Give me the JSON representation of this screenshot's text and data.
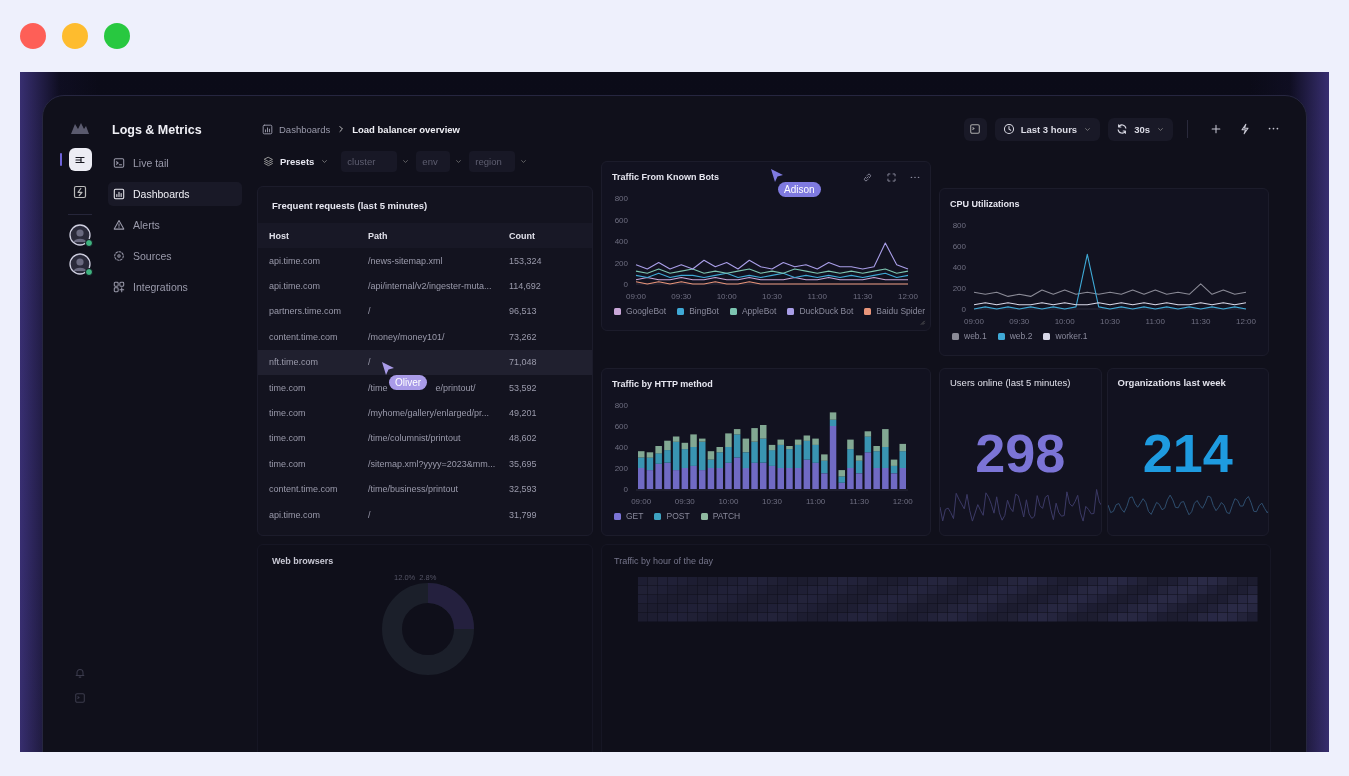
{
  "window": {
    "traffic_lights": [
      {
        "color": "#fe5f57"
      },
      {
        "color": "#febc2e"
      },
      {
        "color": "#28c840"
      }
    ]
  },
  "app": {
    "title": "Logs & Metrics"
  },
  "rail": {
    "items": [
      {
        "kind": "toggle",
        "selected": true
      },
      {
        "kind": "bolt",
        "selected": false
      }
    ],
    "avatars": [
      {
        "online": true
      },
      {
        "online": true
      }
    ]
  },
  "nav": [
    {
      "kind": "terminal",
      "label": "Live tail",
      "selected": false
    },
    {
      "kind": "dashboards",
      "label": "Dashboards",
      "selected": true
    },
    {
      "kind": "alert",
      "label": "Alerts",
      "selected": false
    },
    {
      "kind": "sources",
      "label": "Sources",
      "selected": false
    },
    {
      "kind": "integrations",
      "label": "Integrations",
      "selected": false
    }
  ],
  "breadcrumb": {
    "parent": "Dashboards",
    "current": "Load balancer overview"
  },
  "toolbar": {
    "time_range": "Last 3 hours",
    "refresh": "30s"
  },
  "filters": {
    "presets": "Presets",
    "fields": [
      {
        "placeholder": "cluster"
      },
      {
        "placeholder": "env"
      },
      {
        "placeholder": "region"
      }
    ]
  },
  "requests": {
    "title": "Frequent requests (last 5 minutes)",
    "columns": [
      "Host",
      "Path",
      "Count"
    ],
    "rows": [
      {
        "host": "api.time.com",
        "path": "/news-sitemap.xml",
        "count": "153,324",
        "selected": false
      },
      {
        "host": "api.time.com",
        "path": "/api/internal/v2/ingester-muta...",
        "count": "114,692",
        "selected": false
      },
      {
        "host": "partners.time.com",
        "path": "/",
        "count": "96,513",
        "selected": false
      },
      {
        "host": "content.time.com",
        "path": "/money/money101/",
        "count": "73,262",
        "selected": false
      },
      {
        "host": "nft.time.com",
        "path": "/",
        "count": "71,048",
        "selected": true
      },
      {
        "host": "time.com",
        "path": "/time",
        "path_after_cursor": "e/printout/",
        "count": "53,592",
        "selected": false
      },
      {
        "host": "time.com",
        "path": "/myhome/gallery/enlarged/pr...",
        "count": "49,201",
        "selected": false
      },
      {
        "host": "time.com",
        "path": "/time/columnist/printout",
        "count": "48,602",
        "selected": false
      },
      {
        "host": "time.com",
        "path": "/sitemap.xml?yyyy=2023&mm...",
        "count": "35,695",
        "selected": false
      },
      {
        "host": "content.time.com",
        "path": "/time/business/printout",
        "count": "32,593",
        "selected": false
      },
      {
        "host": "api.time.com",
        "path": "/",
        "count": "31,799",
        "selected": false
      }
    ]
  },
  "bots_chart": {
    "title": "Traffic From Known Bots",
    "chart_data": {
      "type": "line",
      "categories": [
        "09:00",
        null,
        null,
        null,
        "09:30",
        null,
        null,
        null,
        "10:00",
        null,
        null,
        null,
        "10:30",
        null,
        null,
        null,
        "11:00",
        null,
        null,
        null,
        "11:30",
        null,
        null,
        null,
        "12:00"
      ],
      "ylim": [
        0,
        800
      ],
      "yticks": [
        0,
        200,
        400,
        600,
        800
      ],
      "series": [
        {
          "name": "GoogleBot",
          "color": "#c9a7d8",
          "values": [
            40,
            60,
            40,
            40,
            60,
            40,
            40,
            60,
            40,
            40,
            60,
            40,
            40,
            40,
            60,
            40,
            40,
            60,
            40,
            40,
            40,
            60,
            40,
            40,
            40
          ]
        },
        {
          "name": "BingBot",
          "color": "#3fa9d6",
          "values": [
            80,
            60,
            100,
            60,
            80,
            80,
            60,
            80,
            100,
            60,
            80,
            60,
            80,
            100,
            60,
            80,
            60,
            80,
            60,
            80,
            60,
            80,
            100,
            60,
            80
          ]
        },
        {
          "name": "AppleBot",
          "color": "#7cc4b0",
          "values": [
            120,
            100,
            140,
            100,
            120,
            140,
            100,
            120,
            100,
            120,
            140,
            100,
            120,
            100,
            140,
            120,
            100,
            120,
            100,
            120,
            100,
            120,
            140,
            100,
            120
          ]
        },
        {
          "name": "DuckDuck Bot",
          "color": "#a99ee8",
          "values": [
            180,
            140,
            200,
            140,
            180,
            140,
            220,
            160,
            200,
            140,
            220,
            160,
            140,
            200,
            160,
            180,
            140,
            200,
            160,
            160,
            140,
            160,
            380,
            180,
            140
          ]
        },
        {
          "name": "Baidu Spider",
          "color": "#e8957a",
          "values": [
            20,
            0,
            20,
            0,
            20,
            0,
            0,
            20,
            0,
            0,
            20,
            0,
            0,
            0,
            0,
            0,
            0,
            0,
            0,
            0,
            0,
            0,
            0,
            0,
            0
          ]
        }
      ]
    }
  },
  "cpu_chart": {
    "title": "CPU Utilizations",
    "chart_data": {
      "type": "line",
      "categories": [
        "09:00",
        null,
        null,
        null,
        "09:30",
        null,
        null,
        null,
        "10:00",
        null,
        null,
        null,
        "10:30",
        null,
        null,
        null,
        "11:00",
        null,
        null,
        null,
        "11:30",
        null,
        null,
        null,
        "12:00"
      ],
      "ylim": [
        0,
        800
      ],
      "yticks": [
        0,
        200,
        400,
        600,
        800
      ],
      "series": [
        {
          "name": "web.1",
          "color": "#8a8a96",
          "values": [
            160,
            140,
            160,
            120,
            140,
            120,
            180,
            140,
            180,
            140,
            160,
            140,
            160,
            140,
            180,
            140,
            180,
            140,
            160,
            140,
            240,
            140,
            180,
            140,
            160
          ]
        },
        {
          "name": "web.2",
          "color": "#3fa9d6",
          "values": [
            0,
            20,
            0,
            20,
            0,
            20,
            0,
            20,
            0,
            20,
            520,
            20,
            0,
            20,
            0,
            20,
            0,
            20,
            0,
            20,
            0,
            20,
            0,
            20,
            0
          ]
        },
        {
          "name": "worker.1",
          "color": "#d8d8e8",
          "values": [
            40,
            60,
            40,
            60,
            40,
            40,
            60,
            40,
            60,
            40,
            40,
            60,
            40,
            60,
            40,
            60,
            40,
            60,
            40,
            40,
            60,
            40,
            60,
            40,
            60
          ]
        }
      ]
    }
  },
  "http_chart": {
    "title": "Traffic by HTTP method",
    "chart_data": {
      "type": "bar",
      "stacked": true,
      "categories": [
        "09:00",
        null,
        null,
        null,
        null,
        "09:30",
        null,
        null,
        null,
        null,
        "10:00",
        null,
        null,
        null,
        null,
        "10:30",
        null,
        null,
        null,
        null,
        "11:00",
        null,
        null,
        null,
        null,
        "11:30",
        null,
        null,
        null,
        null,
        "12:00"
      ],
      "ylim": [
        0,
        800
      ],
      "yticks": [
        0,
        200,
        400,
        600,
        800
      ],
      "series": [
        {
          "name": "GET",
          "color": "#7b74d6",
          "values": [
            200,
            180,
            240,
            250,
            180,
            200,
            220,
            180,
            200,
            200,
            250,
            300,
            200,
            250,
            250,
            220,
            200,
            200,
            200,
            280,
            250,
            150,
            600,
            60,
            200,
            150,
            350,
            200,
            200,
            150,
            200
          ]
        },
        {
          "name": "POST",
          "color": "#3ea3c2",
          "values": [
            100,
            120,
            100,
            120,
            270,
            180,
            180,
            270,
            80,
            150,
            150,
            220,
            150,
            200,
            230,
            150,
            220,
            180,
            220,
            180,
            170,
            120,
            60,
            60,
            180,
            120,
            150,
            160,
            200,
            70,
            160
          ]
        },
        {
          "name": "PATCH",
          "color": "#8fb9a0",
          "values": [
            60,
            50,
            70,
            90,
            50,
            60,
            120,
            30,
            80,
            50,
            130,
            50,
            130,
            130,
            130,
            50,
            50,
            30,
            50,
            50,
            60,
            60,
            70,
            60,
            90,
            50,
            50,
            50,
            170,
            60,
            70
          ]
        }
      ]
    }
  },
  "stats": [
    {
      "title": "Users online (last 5 minutes)",
      "value": "298",
      "color": "#7b74d6"
    },
    {
      "title": "Organizations last week",
      "value": "214",
      "color": "#1e9be0"
    }
  ],
  "web_browsers": {
    "title": "Web browsers",
    "labels": [
      "12.0%",
      "2.8%"
    ]
  },
  "hourly_traffic": {
    "title": "Traffic by hour of the day"
  },
  "cursors": [
    {
      "name": "Adison",
      "color": "#7f7ae0"
    },
    {
      "name": "Oliver",
      "color": "#a99be8"
    }
  ]
}
